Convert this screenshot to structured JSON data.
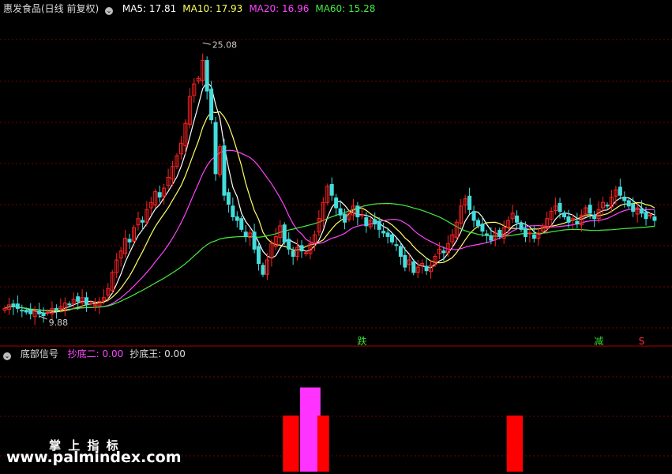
{
  "main_panel": {
    "title": "惠发食品(日线 前复权)",
    "ma_labels": [
      {
        "name": "MA5",
        "text": "MA5: 17.81",
        "color": "#ffffff"
      },
      {
        "name": "MA10",
        "text": "MA10: 17.93",
        "color": "#ffff66"
      },
      {
        "name": "MA20",
        "text": "MA20: 16.96",
        "color": "#ff44ff"
      },
      {
        "name": "MA60",
        "text": "MA60: 15.28",
        "color": "#44ee44"
      }
    ],
    "annotations": [
      {
        "text": "25.08",
        "x": 46,
        "y": 25.08
      },
      {
        "text": "9.88",
        "x": 8,
        "y": 9.88
      }
    ],
    "signals": [
      {
        "text": "跌",
        "x": 83,
        "color": "#33dd33"
      },
      {
        "text": "减",
        "x": 138,
        "color": "#33dd33"
      },
      {
        "text": "S",
        "x": 148,
        "color": "#ff3333"
      }
    ]
  },
  "sub_panel": {
    "title": "底部信号",
    "labels": [
      {
        "text": "抄底二: 0.00",
        "color": "#ff44ff"
      },
      {
        "text": "抄底王: 0.00",
        "color": "#dddddd"
      }
    ]
  },
  "watermark": {
    "line1": "掌 上 指 标",
    "line2": "www.palmindex.com"
  },
  "colors": {
    "up": "#ff2222",
    "down": "#44dddd",
    "ma5": "#ffffff",
    "ma10": "#ffff66",
    "ma20": "#ff44ff",
    "ma60": "#44ee44",
    "grid": "#7a0000"
  },
  "chart_data": {
    "type": "candlestick",
    "ylim": [
      9.0,
      26.5
    ],
    "closes": [
      10.3,
      10.5,
      10.4,
      10.3,
      10.2,
      10.1,
      10.0,
      10.2,
      10.0,
      9.9,
      10.1,
      10.3,
      10.2,
      10.4,
      10.6,
      10.5,
      10.8,
      10.7,
      10.9,
      10.5,
      10.6,
      10.5,
      10.7,
      10.9,
      11.4,
      12.3,
      13.0,
      13.5,
      14.2,
      14.0,
      14.8,
      15.3,
      15.1,
      15.8,
      16.2,
      16.8,
      16.5,
      17.0,
      17.6,
      18.2,
      18.8,
      19.5,
      20.6,
      22.1,
      22.8,
      23.1,
      24.1,
      22.4,
      20.8,
      17.8,
      19.3,
      16.6,
      16.1,
      15.4,
      15.2,
      14.7,
      14.3,
      14.5,
      13.6,
      12.8,
      12.2,
      13.0,
      13.9,
      14.3,
      14.9,
      14.0,
      13.6,
      13.2,
      13.7,
      13.5,
      13.4,
      13.9,
      14.4,
      15.3,
      16.2,
      17.1,
      16.6,
      15.9,
      15.5,
      15.1,
      15.6,
      16.0,
      15.4,
      15.5,
      14.9,
      15.2,
      15.0,
      14.7,
      14.5,
      14.3,
      14.0,
      13.8,
      13.2,
      12.6,
      13.0,
      12.3,
      12.6,
      12.8,
      12.4,
      12.7,
      13.2,
      13.6,
      13.4,
      13.9,
      14.4,
      15.1,
      16.0,
      16.4,
      15.8,
      15.2,
      14.9,
      14.6,
      14.4,
      14.1,
      14.5,
      14.3,
      14.8,
      15.2,
      15.6,
      15.1,
      14.7,
      14.3,
      14.5,
      14.2,
      14.5,
      14.9,
      15.3,
      15.7,
      16.0,
      15.7,
      15.4,
      15.1,
      15.3,
      15.0,
      15.5,
      15.9,
      15.6,
      15.3,
      15.8,
      16.2,
      16.0,
      16.5,
      16.9,
      16.6,
      16.3,
      16.0,
      15.7,
      15.9,
      15.6,
      15.3,
      15.5,
      15.2
    ],
    "ma_series": [
      {
        "name": "MA5",
        "window": 5
      },
      {
        "name": "MA10",
        "window": 10
      },
      {
        "name": "MA20",
        "window": 20
      },
      {
        "name": "MA60",
        "window": 60
      }
    ],
    "sub_bars": [
      {
        "x_start": 65,
        "x_end": 68,
        "value": 1.0,
        "color": "#ff0000"
      },
      {
        "x_start": 69,
        "x_end": 73,
        "value": 1.5,
        "color": "#ff33ff"
      },
      {
        "x_start": 73,
        "x_end": 75,
        "value": 1.0,
        "color": "#ff0000"
      },
      {
        "x_start": 117,
        "x_end": 120,
        "value": 1.0,
        "color": "#ff0000"
      }
    ],
    "sub_ylim": [
      0,
      2.0
    ]
  }
}
